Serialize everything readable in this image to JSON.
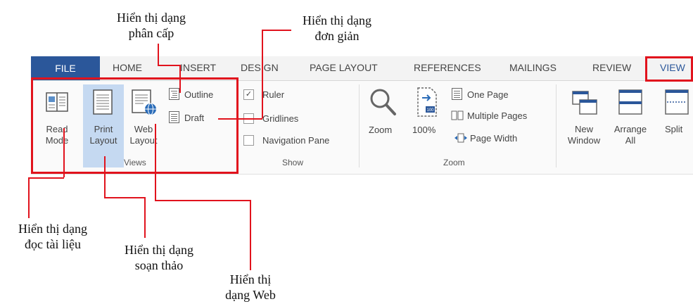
{
  "tabs": {
    "file": "FILE",
    "home": "HOME",
    "insert": "INSERT",
    "design": "DESIGN",
    "page_layout": "PAGE LAYOUT",
    "references": "REFERENCES",
    "mailings": "MAILINGS",
    "review": "REVIEW",
    "view": "VIEW"
  },
  "views": {
    "read_mode": [
      "Read",
      "Mode"
    ],
    "print_layout": [
      "Print",
      "Layout"
    ],
    "web_layout": [
      "Web",
      "Layout"
    ],
    "outline": "Outline",
    "draft": "Draft",
    "group": "Views"
  },
  "show": {
    "ruler": "Ruler",
    "gridlines": "Gridlines",
    "navigation_pane": "Navigation Pane",
    "group": "Show"
  },
  "zoom": {
    "zoom": "Zoom",
    "hundred": "100%",
    "one_page": "One Page",
    "multiple_pages": "Multiple Pages",
    "page_width": "Page Width",
    "group": "Zoom"
  },
  "window": {
    "new_window": [
      "New",
      "Window"
    ],
    "arrange_all": [
      "Arrange",
      "All"
    ],
    "split": "Split"
  },
  "callouts": {
    "outline": [
      "Hiển thị dạng",
      "phân cấp"
    ],
    "draft": [
      "Hiển thị dạng",
      "đơn giản"
    ],
    "read_mode": [
      "Hiển thị dạng",
      "đọc tài liệu"
    ],
    "print_layout": [
      "Hiển thị dạng",
      "soạn thảo"
    ],
    "web_layout": [
      "Hiển thị",
      "dạng Web"
    ]
  }
}
